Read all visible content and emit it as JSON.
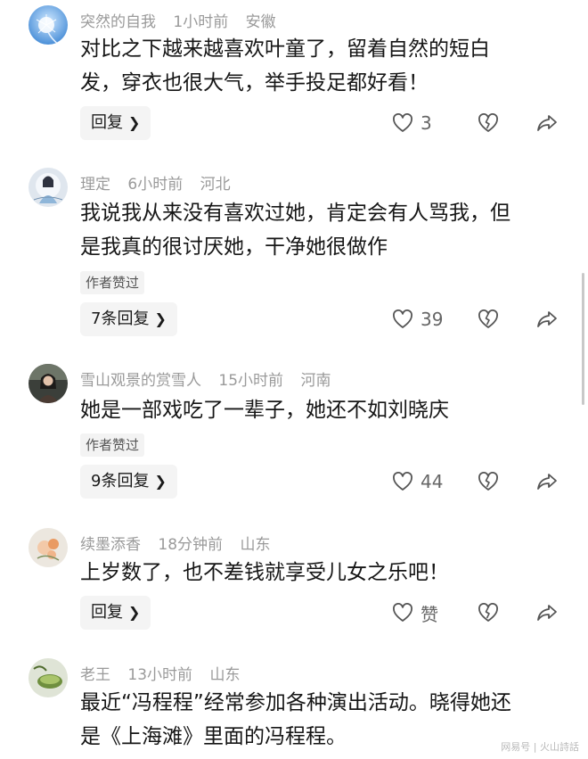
{
  "comments": [
    {
      "username": "突然的自我",
      "time": "1小时前",
      "location": "安徽",
      "lines": [
        "对比之下越来越喜欢叶童了，留着自然的短白",
        "发，穿衣也很大气，举手投足都好看！"
      ],
      "author_liked": "",
      "reply_label": "回复",
      "like_count": "3",
      "avatar_icon": "dandelion-photo"
    },
    {
      "username": "理定",
      "time": "6小时前",
      "location": "河北",
      "lines": [
        "我说我从来没有喜欢过她，肯定会有人骂我，但",
        "是我真的很讨厌她，干净她很做作"
      ],
      "author_liked": "作者赞过",
      "reply_label": "7条回复",
      "like_count": "39",
      "avatar_icon": "illustrated-figure"
    },
    {
      "username": "雪山观景的赏雪人",
      "time": "15小时前",
      "location": "河南",
      "lines": [
        "她是一部戏吃了一辈子，她还不如刘晓庆"
      ],
      "author_liked": "作者赞过",
      "reply_label": "9条回复",
      "like_count": "44",
      "avatar_icon": "portrait-photo"
    },
    {
      "username": "续墨添香",
      "time": "18分钟前",
      "location": "山东",
      "lines": [
        "上岁数了，也不差钱就享受儿女之乐吧！"
      ],
      "author_liked": "",
      "reply_label": "回复",
      "like_count": "赞",
      "avatar_icon": "flower-photo"
    },
    {
      "username": "老王",
      "time": "13小时前",
      "location": "山东",
      "lines": [
        "最近“冯程程”经常参加各种演出活动。晓得她还",
        "是《上海滩》里面的冯程程。"
      ],
      "author_liked": "",
      "reply_label": "",
      "like_count": "",
      "avatar_icon": "tea-cup-photo"
    }
  ],
  "watermark": "网易号 | 火山詩話",
  "icons": {
    "like": "heart-icon",
    "dislike": "broken-heart-icon",
    "share": "share-arrow-icon",
    "chevron": "chevron-right-icon"
  }
}
